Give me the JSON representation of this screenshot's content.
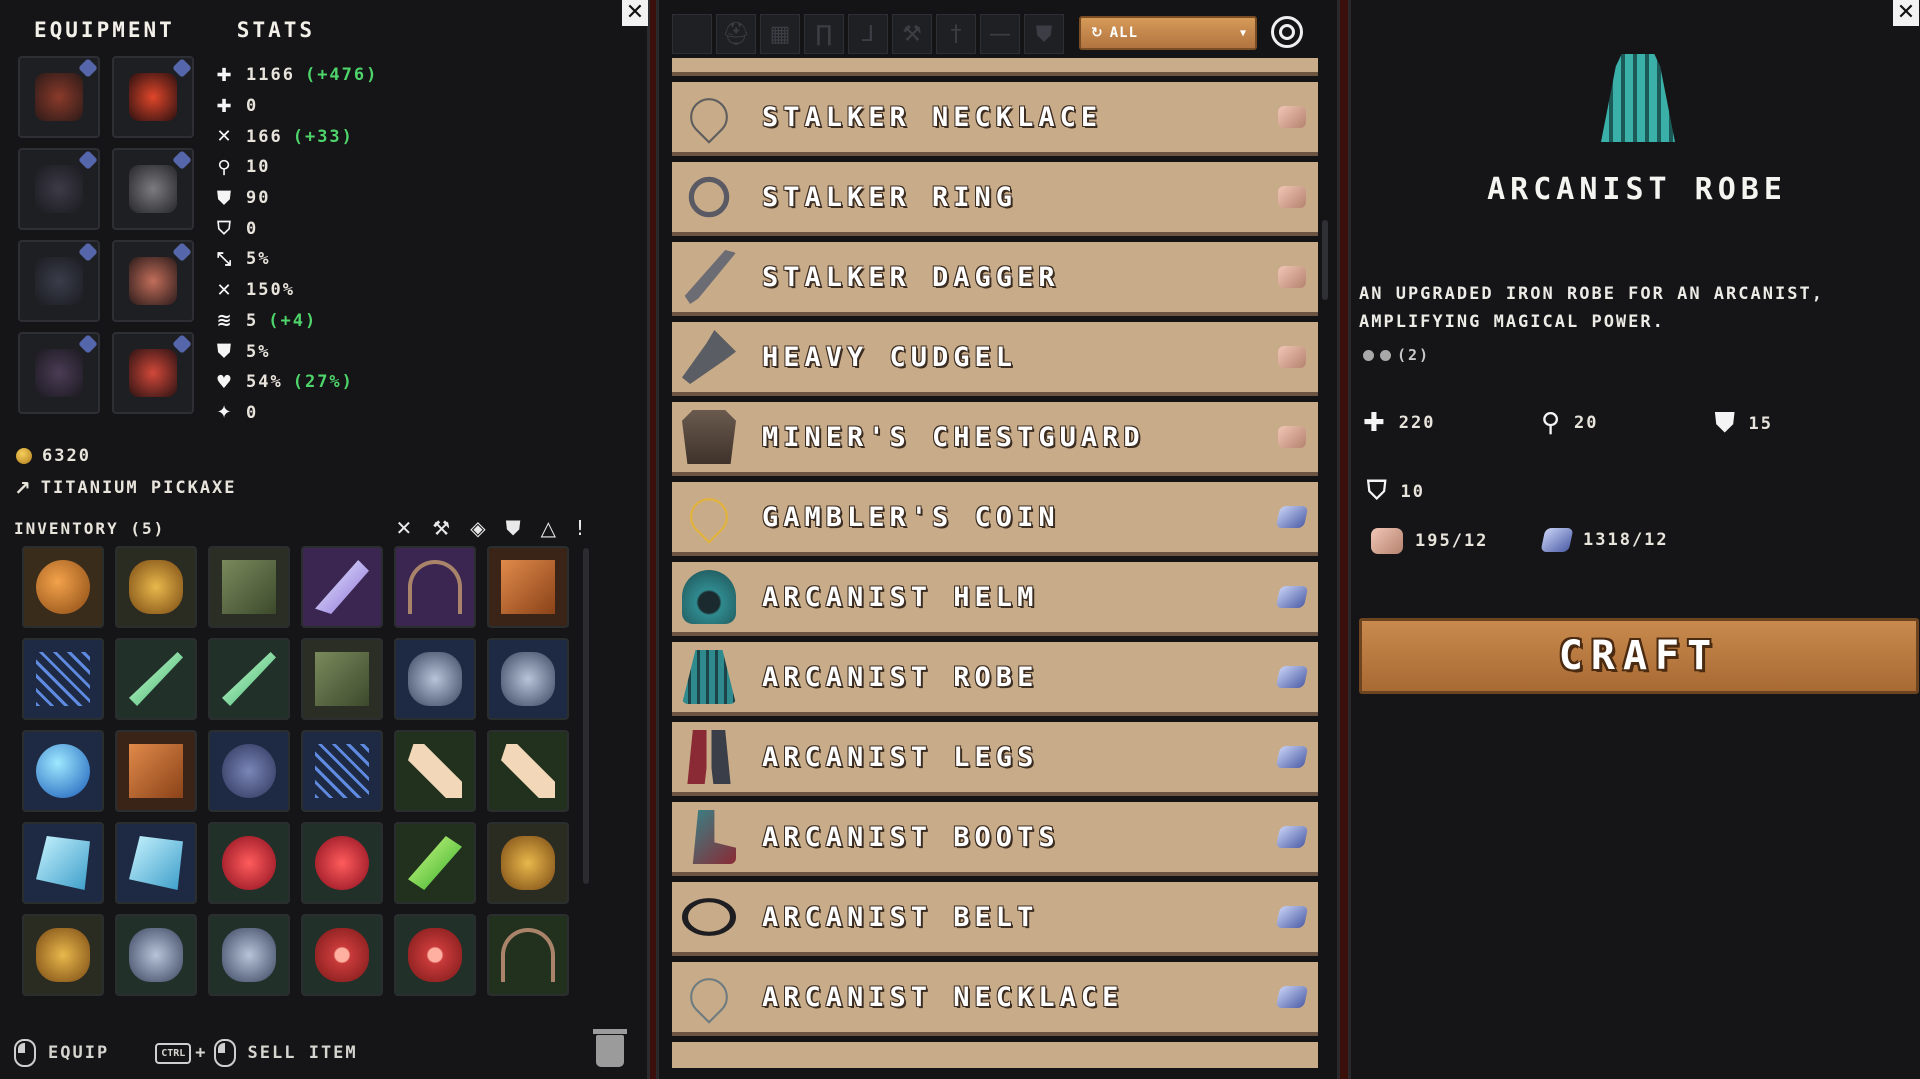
{
  "left": {
    "tabs": [
      "EQUIPMENT",
      "STATS"
    ],
    "stats": [
      {
        "icon": "health-icon",
        "glyph": "✚",
        "value": "1166",
        "bonus": "(+476)"
      },
      {
        "icon": "regen-icon",
        "glyph": "✚",
        "value": "0",
        "bonus": ""
      },
      {
        "icon": "attack-icon",
        "glyph": "✕",
        "value": "166",
        "bonus": "(+33)"
      },
      {
        "icon": "magic-icon",
        "glyph": "⚲",
        "value": "10",
        "bonus": ""
      },
      {
        "icon": "armor-icon",
        "glyph": "⛊",
        "value": "90",
        "bonus": ""
      },
      {
        "icon": "magic-resist-icon",
        "glyph": "⛉",
        "value": "0",
        "bonus": ""
      },
      {
        "icon": "crit-chance-icon",
        "glyph": "⤡",
        "value": "5%",
        "bonus": ""
      },
      {
        "icon": "crit-damage-icon",
        "glyph": "✕",
        "value": "150%",
        "bonus": ""
      },
      {
        "icon": "attack-speed-icon",
        "glyph": "≋",
        "value": "5",
        "bonus": "(+4)"
      },
      {
        "icon": "dodge-icon",
        "glyph": "⛊",
        "value": "5%",
        "bonus": ""
      },
      {
        "icon": "lifesteal-icon",
        "glyph": "♥",
        "value": "54%",
        "bonus": "(27%)"
      },
      {
        "icon": "thorns-icon",
        "glyph": "✦",
        "value": "0",
        "bonus": ""
      }
    ],
    "gold": "6320",
    "tool": "TITANIUM PICKAXE",
    "inventory_title": "INVENTORY (5)",
    "footer": {
      "equip": "EQUIP",
      "ctrl": "CTRL",
      "sell": "SELL ITEM"
    }
  },
  "center": {
    "filter_label": "ALL",
    "recipes": [
      {
        "name": "STALKER NECKLACE",
        "icon": "necklace-icon",
        "material": "iron"
      },
      {
        "name": "STALKER RING",
        "icon": "ring-icon",
        "material": "iron"
      },
      {
        "name": "STALKER DAGGER",
        "icon": "dagger-icon",
        "material": "iron"
      },
      {
        "name": "HEAVY CUDGEL",
        "icon": "cudgel-icon",
        "material": "iron"
      },
      {
        "name": "MINER'S CHESTGUARD",
        "icon": "chestguard-icon",
        "material": "iron"
      },
      {
        "name": "GAMBLER'S COIN",
        "icon": "coin-necklace-icon",
        "material": "cobalt"
      },
      {
        "name": "ARCANIST HELM",
        "icon": "helm-icon",
        "material": "cobalt"
      },
      {
        "name": "ARCANIST ROBE",
        "icon": "robe-icon",
        "material": "cobalt"
      },
      {
        "name": "ARCANIST LEGS",
        "icon": "legs-icon",
        "material": "cobalt"
      },
      {
        "name": "ARCANIST BOOTS",
        "icon": "boots-icon",
        "material": "cobalt"
      },
      {
        "name": "ARCANIST BELT",
        "icon": "belt-icon",
        "material": "cobalt"
      },
      {
        "name": "ARCANIST NECKLACE",
        "icon": "necklace-icon",
        "material": "cobalt"
      }
    ]
  },
  "right": {
    "title": "ARCANIST ROBE",
    "description": "AN UPGRADED IRON ROBE FOR AN ARCANIST, AMPLIFYING MAGICAL POWER.",
    "sockets_label": "(2)",
    "stats": {
      "health": "220",
      "magic": "20",
      "armor": "15",
      "magic_resist": "10"
    },
    "cost": {
      "iron": "195/12",
      "cobalt": "1318/12"
    },
    "craft_label": "CRAFT"
  }
}
